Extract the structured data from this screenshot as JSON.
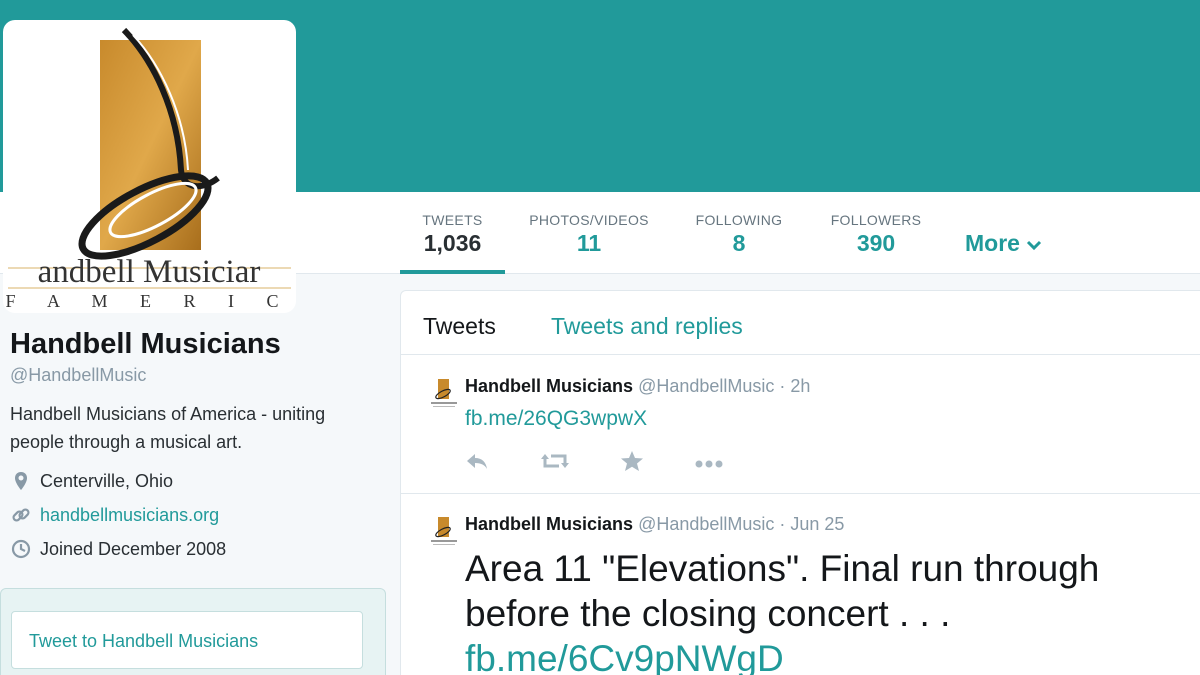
{
  "colors": {
    "header": "#219a9a",
    "accent": "#219a9a",
    "page": "#f5f8fa"
  },
  "avatar": {
    "logo_line1": "andbell Musiciar",
    "logo_line2": "F A M E R I C"
  },
  "nav": {
    "stats": [
      {
        "label": "TWEETS",
        "value": "1,036"
      },
      {
        "label": "PHOTOS/VIDEOS",
        "value": "11"
      },
      {
        "label": "FOLLOWING",
        "value": "8"
      },
      {
        "label": "FOLLOWERS",
        "value": "390"
      }
    ],
    "more_label": "More"
  },
  "profile": {
    "name": "Handbell Musicians",
    "handle": "@HandbellMusic",
    "bio": "Handbell Musicians of America - uniting people through a musical art.",
    "location": "Centerville, Ohio",
    "url": "handbellmusicians.org",
    "joined": "Joined December 2008",
    "tweet_to": "Tweet to Handbell Musicians"
  },
  "stream": {
    "tabs": [
      "Tweets",
      "Tweets and replies"
    ],
    "tweets": [
      {
        "name": "Handbell Musicians",
        "handle": "@HandbellMusic",
        "time": "· 2h",
        "text": "",
        "link": "fb.me/26QG3wpwX"
      },
      {
        "name": "Handbell Musicians",
        "handle": "@HandbellMusic",
        "time": "· Jun 25",
        "text": "Area 11 \"Elevations\". Final run through before the closing concert . . . ",
        "link": "fb.me/6Cv9pNWgD"
      }
    ]
  },
  "icons": [
    "location-pin-icon",
    "link-icon",
    "calendar-icon",
    "reply-icon",
    "retweet-icon",
    "favorite-icon",
    "more-dots-icon",
    "chevron-down-icon"
  ]
}
